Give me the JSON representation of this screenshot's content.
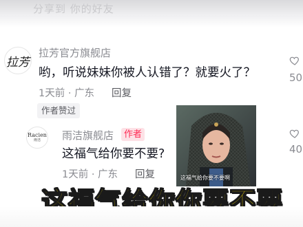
{
  "top": {
    "faded_text": "分享到 你的好友"
  },
  "comment1": {
    "avatar_text": "拉芳",
    "author": "拉芳官方旗舰店",
    "text": "哟，听说妹妹你被人认错了？就要火了？",
    "meta": "1天前 · 广东",
    "reply_label": "回复",
    "liked_label": "作者赞过",
    "like_count": "50",
    "icon": "heart-icon"
  },
  "comment2": {
    "avatar_text": "Racien",
    "avatar_sub": "雨洁",
    "author": "雨洁旗舰店",
    "author_tag": "作者",
    "text": "这福气给你要不要?",
    "meta": "1天前 · 广东",
    "reply_label": "回复",
    "like_count": "40",
    "icon": "heart-icon"
  },
  "video_still": {
    "caption": "这福气给你要不要啊"
  },
  "overlay_caption": "这福气给你你要不要",
  "colors": {
    "author_tag_bg": "#fde1e6",
    "author_tag_text": "#fe2c55",
    "caption_yellow": "#ffe200"
  }
}
